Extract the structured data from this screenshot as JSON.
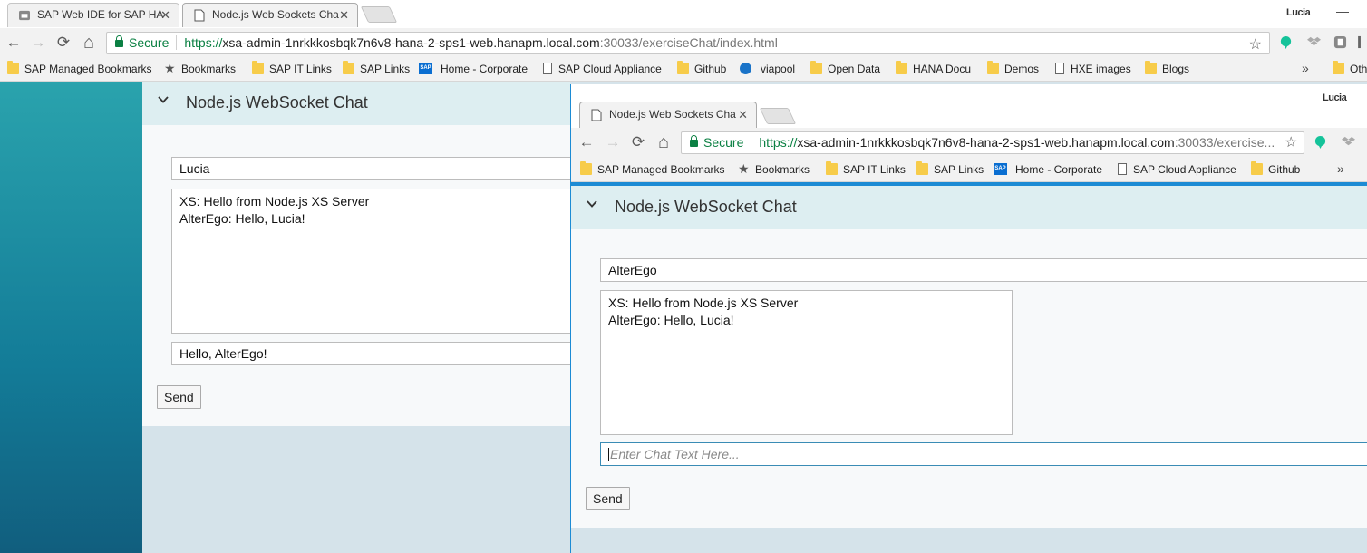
{
  "back_browser": {
    "tabs": [
      {
        "title": "SAP Web IDE for SAP HA",
        "close": "✕"
      },
      {
        "title": "Node.js Web Sockets Cha",
        "close": "✕"
      }
    ],
    "profile": "Lucia",
    "minimize": "—",
    "secure_label": "Secure",
    "url": {
      "scheme": "https://",
      "host": "xsa-admin-1nrkkkosbqk7n6v8-hana-2-sps1-web.hanapm.local.com",
      "rest": ":30033/exerciseChat/index.html"
    },
    "bookmarks": [
      "SAP Managed Bookmarks",
      "Bookmarks",
      "SAP IT Links",
      "SAP Links",
      "Home - Corporate",
      "SAP Cloud Appliance",
      "Github",
      "viapool",
      "Open Data",
      "HANA Docu",
      "Demos",
      "HXE images",
      "Blogs"
    ],
    "overflow": "»",
    "other_bookmarks": "Oth"
  },
  "front_browser": {
    "tabs": [
      {
        "title": "Node.js Web Sockets Cha",
        "close": "✕"
      }
    ],
    "profile": "Lucia",
    "secure_label": "Secure",
    "url": {
      "scheme": "https://",
      "host": "xsa-admin-1nrkkkosbqk7n6v8-hana-2-sps1-web.hanapm.local.com",
      "rest": ":30033/exercise..."
    },
    "bookmarks": [
      "SAP Managed Bookmarks",
      "Bookmarks",
      "SAP IT Links",
      "SAP Links",
      "Home - Corporate",
      "SAP Cloud Appliance",
      "Github"
    ],
    "overflow": "»"
  },
  "chat_back": {
    "title": "Node.js WebSocket Chat",
    "name": "Lucia",
    "messages": [
      "XS: Hello from Node.js XS Server",
      "AlterEgo: Hello, Lucia!"
    ],
    "input_value": "Hello, AlterEgo!",
    "send_label": "Send"
  },
  "chat_front": {
    "title": "Node.js WebSocket Chat",
    "name": "AlterEgo",
    "messages": [
      "XS: Hello from Node.js XS Server",
      "AlterEgo: Hello, Lucia!"
    ],
    "input_placeholder": "Enter Chat Text Here...",
    "send_label": "Send"
  },
  "icons": {
    "back": "←",
    "forward": "→",
    "reload": "⟳",
    "home": "⌂",
    "bookmark_star": "☆",
    "star_glyph": "★",
    "sap_glyph": "SAP"
  },
  "colors": {
    "accent": "#1c8bd4",
    "secure": "#0b8043",
    "header_bg": "#ddeef1",
    "teal": "#1e8fa3"
  }
}
